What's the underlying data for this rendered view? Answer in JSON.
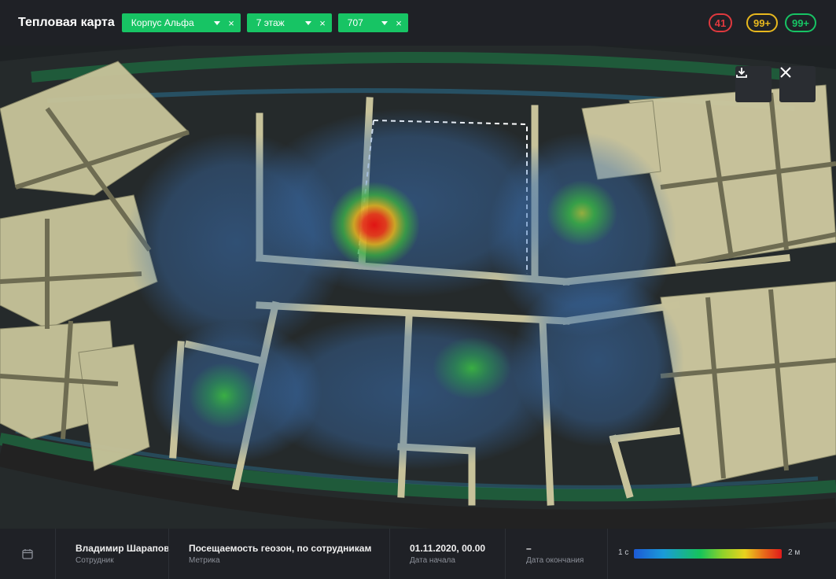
{
  "header": {
    "title": "Тепловая карта",
    "filters": [
      {
        "label": "Корпус Альфа",
        "remove": "×"
      },
      {
        "label": "7 этаж",
        "remove": "×"
      },
      {
        "label": "707",
        "remove": "×"
      }
    ],
    "badges": [
      {
        "value": "41",
        "color": "#e0393e"
      },
      {
        "value": "99+",
        "color": "#e8b81e"
      },
      {
        "value": "99+",
        "color": "#17c464"
      }
    ]
  },
  "toolbar": {
    "download_icon": "download-icon",
    "close_icon": "close-icon"
  },
  "footer": {
    "calendar_icon": "calendar-icon",
    "employee": {
      "value": "Владимир Шарапов",
      "label": "Сотрудник"
    },
    "metric": {
      "value": "Посещаемость геозон, по сотрудникам",
      "label": "Метрика"
    },
    "start": {
      "value": "01.11.2020, 00.00",
      "label": "Дата начала"
    },
    "end": {
      "value": "–",
      "label": "Дата окончания"
    },
    "legend": {
      "min": "1 с",
      "max": "2 м"
    }
  },
  "colors": {
    "accent": "#17c464",
    "header_bg": "#1f2126",
    "heat_hot": "#e01a1a",
    "heat_cold": "#1d5ad6"
  }
}
